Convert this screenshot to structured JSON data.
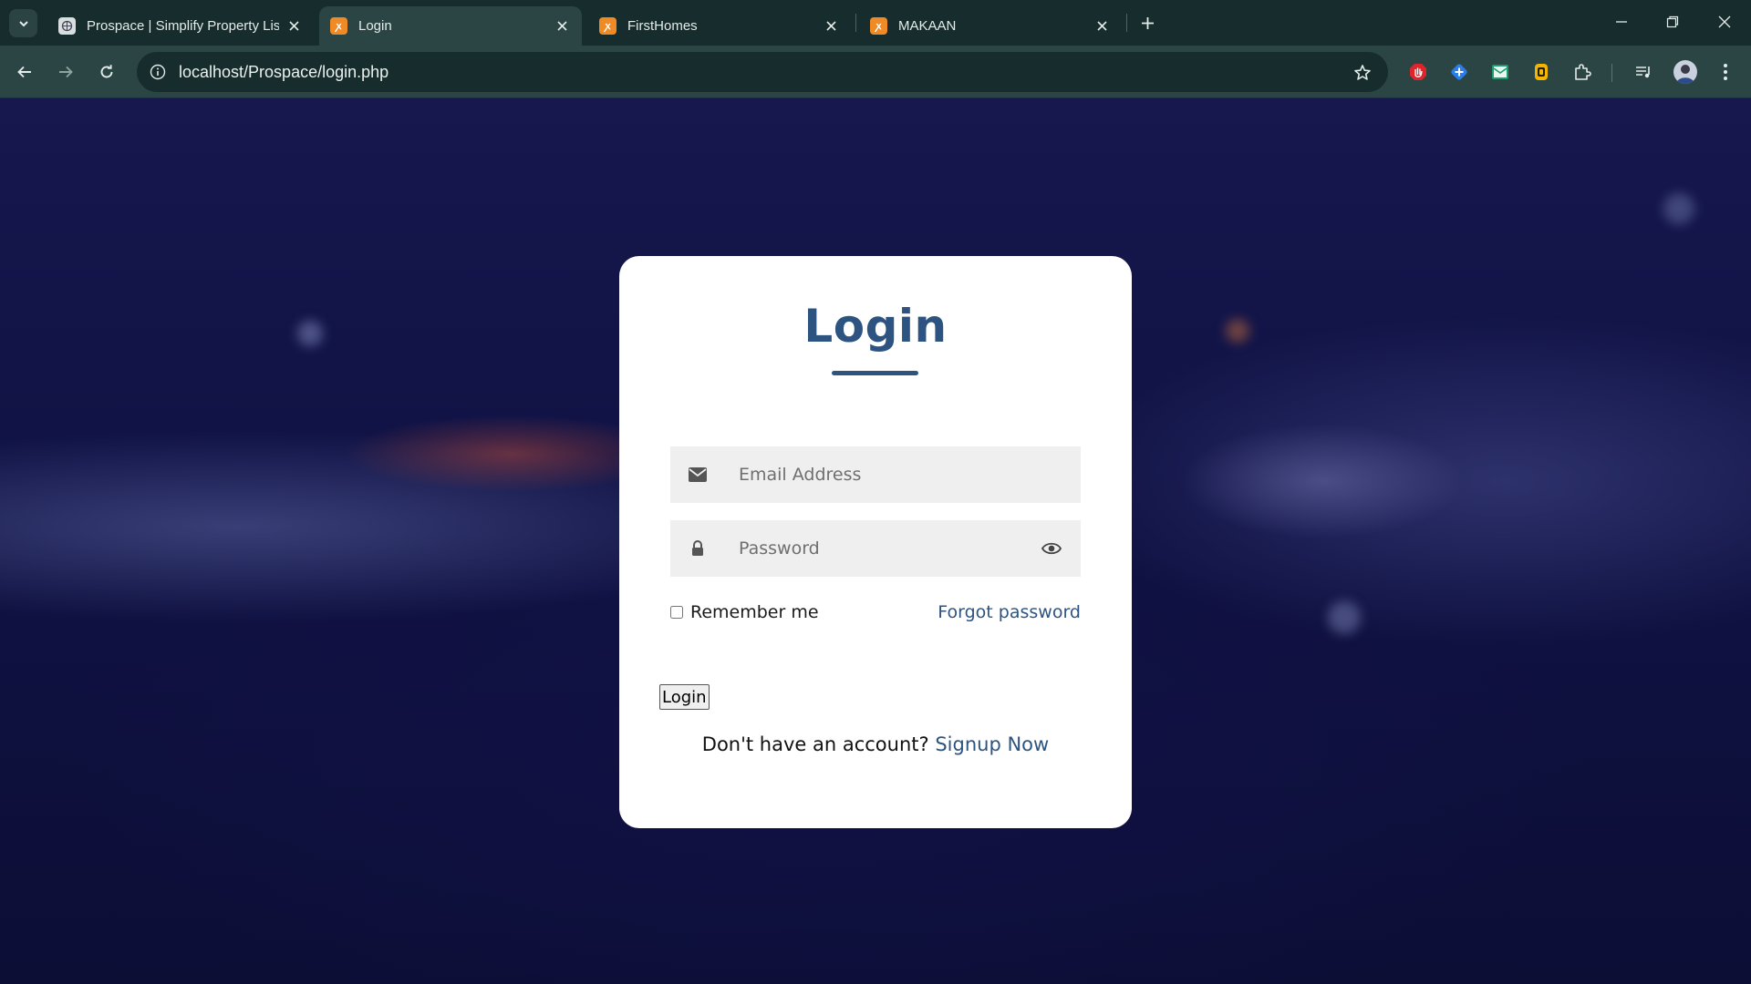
{
  "browser": {
    "tabs": [
      {
        "title": "Prospace | Simplify Property Lis",
        "favicon": "globe-icon",
        "active": false
      },
      {
        "title": "Login",
        "favicon": "xampp-icon",
        "active": true
      },
      {
        "title": "FirstHomes",
        "favicon": "xampp-icon",
        "active": false
      },
      {
        "title": "MAKAAN",
        "favicon": "xampp-icon",
        "active": false
      }
    ],
    "url": "localhost/Prospace/login.php",
    "extensions": [
      "adblock-icon",
      "puzzle-blue-icon",
      "mail-icon",
      "honey-icon",
      "extensions-icon"
    ]
  },
  "form": {
    "heading": "Login",
    "email_placeholder": "Email Address",
    "password_placeholder": "Password",
    "remember_label": "Remember me",
    "forgot_label": "Forgot password",
    "submit_label": "Login",
    "signup_prompt": "Don't have an account?",
    "signup_link": "Signup Now"
  },
  "colors": {
    "accent": "#2d5481",
    "card": "#ffffff",
    "field_bg": "#efefef",
    "chrome_dark": "#172c2c",
    "chrome_toolbar": "#2b4545"
  }
}
